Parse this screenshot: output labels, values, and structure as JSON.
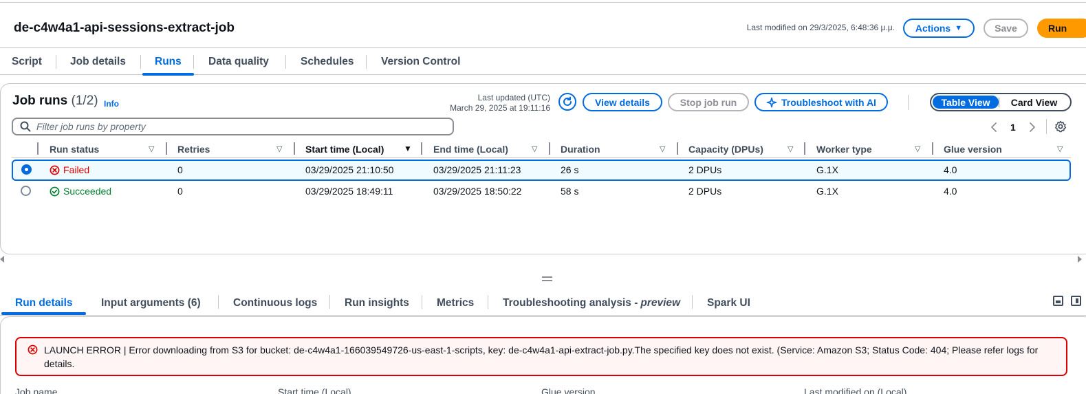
{
  "header": {
    "job_title": "de-c4w4a1-api-sessions-extract-job",
    "last_modified": "Last modified on 29/3/2025, 6:48:36 μ.μ.",
    "actions_label": "Actions",
    "save_label": "Save",
    "run_label": "Run"
  },
  "tabs": [
    "Script",
    "Job details",
    "Runs",
    "Data quality",
    "Schedules",
    "Version Control"
  ],
  "runs": {
    "title": "Job runs",
    "count": "(1/2)",
    "info": "Info",
    "last_updated_label": "Last updated (UTC)",
    "last_updated_value": "March 29, 2025 at 19:11:16",
    "view_details": "View details",
    "stop_job_run": "Stop job run",
    "troubleshoot_ai": "Troubleshoot with AI",
    "table_view": "Table View",
    "card_view": "Card View",
    "filter_placeholder": "Filter job runs by property",
    "page": "1",
    "columns": [
      "Run status",
      "Retries",
      "Start time (Local)",
      "End time (Local)",
      "Duration",
      "Capacity (DPUs)",
      "Worker type",
      "Glue version"
    ],
    "rows": [
      {
        "status": "Failed",
        "retries": "0",
        "start": "03/29/2025 21:10:50",
        "end": "03/29/2025 21:11:23",
        "duration": "26 s",
        "capacity": "2 DPUs",
        "worker": "G.1X",
        "glue": "4.0"
      },
      {
        "status": "Succeeded",
        "retries": "0",
        "start": "03/29/2025 18:49:11",
        "end": "03/29/2025 18:50:22",
        "duration": "58 s",
        "capacity": "2 DPUs",
        "worker": "G.1X",
        "glue": "4.0"
      }
    ]
  },
  "bottom_tabs": {
    "run_details": "Run details",
    "input_arguments": "Input arguments (6)",
    "continuous_logs": "Continuous logs",
    "run_insights": "Run insights",
    "metrics": "Metrics",
    "troubleshooting": "Troubleshooting analysis -",
    "troubleshooting_suffix": "preview",
    "spark_ui": "Spark UI"
  },
  "alert": {
    "message": "LAUNCH ERROR | Error downloading from S3 for bucket: de-c4w4a1-166039549726-us-east-1-scripts, key: de-c4w4a1-api-extract-job.py.The specified key does not exist. (Service: Amazon S3; Status Code: 404; Please refer logs for details."
  },
  "details_labels": [
    "Job name",
    "Start time (Local)",
    "Glue version",
    "Last modified on (Local)"
  ],
  "colors": {
    "accent": "#006ce0",
    "run_button": "#ff9900",
    "error": "#db0000",
    "success": "#00802f"
  },
  "icons": [
    "chevron-down-icon",
    "refresh-icon",
    "sparkle-icon",
    "search-icon",
    "chevron-left-icon",
    "chevron-right-icon",
    "gear-icon",
    "sort-icon",
    "error-icon",
    "success-icon",
    "drag-handle-icon",
    "layout-bottom-icon",
    "layout-side-icon"
  ]
}
